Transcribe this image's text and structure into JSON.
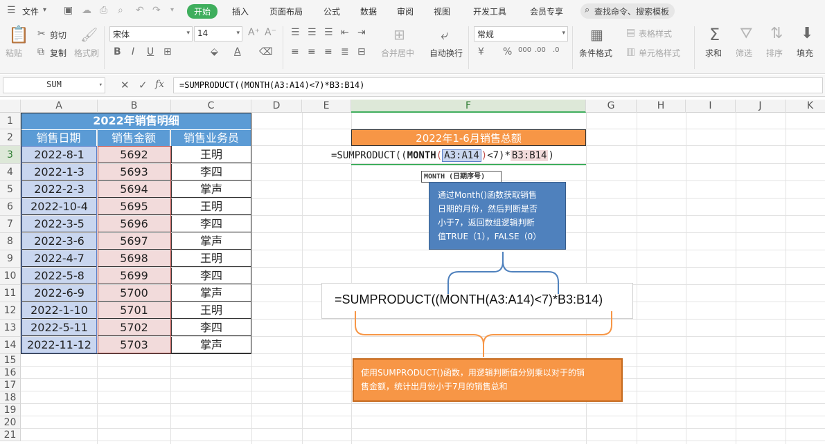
{
  "menubar": {
    "file": "文件",
    "tabs": [
      "开始",
      "插入",
      "页面布局",
      "公式",
      "数据",
      "审阅",
      "视图",
      "开发工具",
      "会员专享"
    ],
    "search_placeholder": "查找命令、搜索模板"
  },
  "ribbon": {
    "paste": "粘贴",
    "cut": "剪切",
    "copy": "复制",
    "format_painter": "格式刷",
    "font_name": "宋体",
    "font_size": "14",
    "merge_center": "合并居中",
    "wrap_text": "自动换行",
    "number_format": "常规",
    "conditional_format": "条件格式",
    "table_style": "表格样式",
    "cell_style": "单元格样式",
    "sum": "求和",
    "filter": "筛选",
    "sort": "排序",
    "fill": "填充"
  },
  "formula_bar": {
    "name_box": "SUM",
    "fx": "fx",
    "formula": "=SUMPRODUCT((MONTH(A3:A14)<7)*B3:B14)"
  },
  "grid": {
    "columns": [
      "A",
      "B",
      "C",
      "D",
      "E",
      "F",
      "G",
      "H",
      "I",
      "J",
      "K"
    ],
    "rows": [
      "1",
      "2",
      "3",
      "4",
      "5",
      "6",
      "7",
      "8",
      "9",
      "10",
      "11",
      "12",
      "13",
      "14",
      "15",
      "16",
      "17",
      "18",
      "19",
      "20",
      "21"
    ],
    "table_title": "2022年销售明细",
    "headers": [
      "销售日期",
      "销售金额",
      "销售业务员"
    ],
    "data": [
      [
        "2022-8-1",
        "5692",
        "王明"
      ],
      [
        "2022-1-3",
        "5693",
        "李四"
      ],
      [
        "2022-2-3",
        "5694",
        "掌声"
      ],
      [
        "2022-10-4",
        "5695",
        "王明"
      ],
      [
        "2022-3-5",
        "5696",
        "李四"
      ],
      [
        "2022-3-6",
        "5697",
        "掌声"
      ],
      [
        "2022-4-7",
        "5698",
        "王明"
      ],
      [
        "2022-5-8",
        "5699",
        "李四"
      ],
      [
        "2022-6-9",
        "5700",
        "掌声"
      ],
      [
        "2022-1-10",
        "5701",
        "王明"
      ],
      [
        "2022-5-11",
        "5702",
        "李四"
      ],
      [
        "2022-11-12",
        "5703",
        "掌声"
      ]
    ],
    "f2_title": "2022年1-6月销售总额",
    "edit_formula": {
      "prefix": "=SUMPRODUCT((",
      "func": "MONTH",
      "open": "(",
      "range1": "A3:A14",
      "close": ")",
      "mid": "<7)*",
      "range2": "B3:B14",
      "end": ")"
    },
    "tooltip": "MONTH (日期序号)"
  },
  "annotations": {
    "blue_note": "通过Month()函数获取销售\n日期的月份，然后判断是否\n小于7，返回数组逻辑判断\n值TRUE（1），FALSE（0）",
    "formula_box": "=SUMPRODUCT((MONTH(A3:A14)<7)*B3:B14)",
    "orange_note": "使用SUMPRODUCT()函数，用逻辑判断值分别乘以对于的销\n售金额，统计出月份小于7月的销售总和"
  },
  "colors": {
    "accent_green": "#3fae5d",
    "header_blue": "#5b9bd5",
    "note_blue": "#4f81bd",
    "note_orange": "#f79646"
  }
}
